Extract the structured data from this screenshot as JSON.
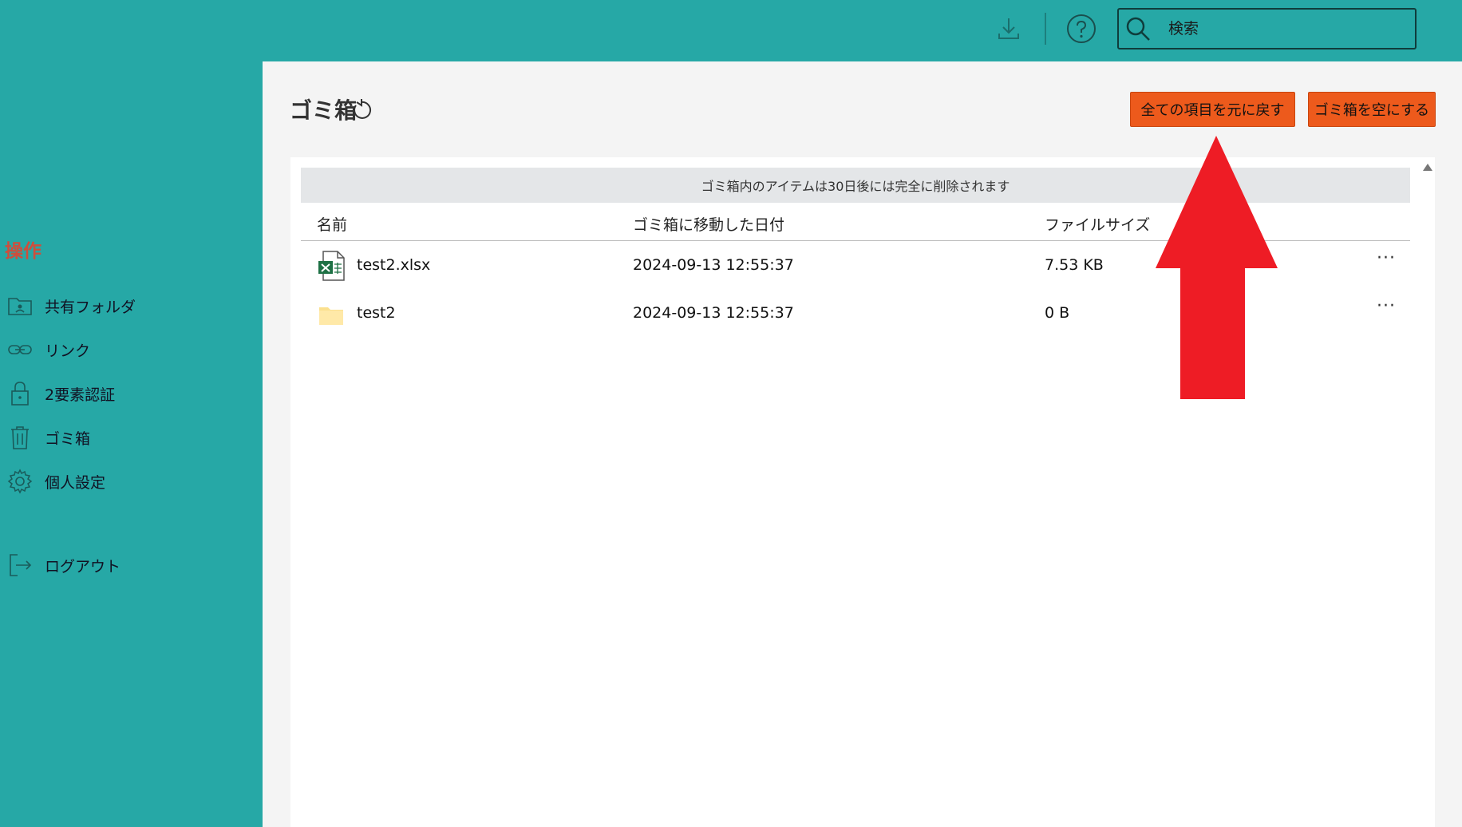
{
  "topbar": {
    "download_icon": "download-icon",
    "help_icon": "help-circle-icon",
    "search_placeholder": "検索",
    "search_icon": "search-icon"
  },
  "sidebar": {
    "heading": "操作",
    "items": [
      {
        "label": "共有フォルダ",
        "icon": "shared-folder-icon"
      },
      {
        "label": "リンク",
        "icon": "link-icon"
      },
      {
        "label": "2要素認証",
        "icon": "lock-icon"
      },
      {
        "label": "ゴミ箱",
        "icon": "trash-icon"
      },
      {
        "label": "個人設定",
        "icon": "gear-icon"
      },
      {
        "label": "ログアウト",
        "icon": "logout-icon"
      }
    ]
  },
  "main": {
    "title": "ゴミ箱",
    "restore_all_label": "全ての項目を元に戻す",
    "empty_trash_label": "ゴミ箱を空にする",
    "notice": "ゴミ箱内のアイテムは30日後には完全に削除されます",
    "columns": {
      "name": "名前",
      "moved_date": "ゴミ箱に移動した日付",
      "size": "ファイルサイズ"
    },
    "rows": [
      {
        "name": "test2.xlsx",
        "date": "2024-09-13 12:55:37",
        "size": "7.53 KB",
        "type": "excel-file-icon",
        "more": "···"
      },
      {
        "name": "test2",
        "date": "2024-09-13 12:55:37",
        "size": "0 B",
        "type": "folder-icon",
        "more": "···"
      }
    ]
  },
  "colors": {
    "brand_teal": "#26a8a6",
    "button_orange": "#ed5a1c",
    "annotation_red": "#ee1c25",
    "heading_red": "#cf4e3c"
  }
}
